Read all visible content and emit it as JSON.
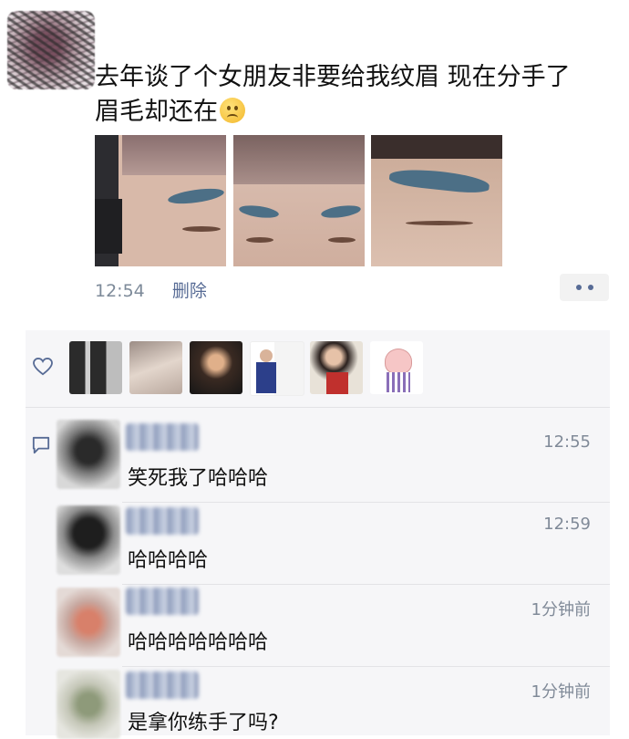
{
  "post": {
    "text_line1": "去年谈了个女朋友非要给我纹眉 现在分手了",
    "text_line2": "眉毛却还在",
    "emoji": "sad-face-emoji",
    "time": "12:54",
    "delete_label": "删除",
    "photos": [
      "side-profile-eyebrow-photo",
      "front-face-eyebrows-photo",
      "closeup-eyebrow-photo"
    ]
  },
  "likes": {
    "icon": "heart-icon",
    "avatars": [
      "like-avatar-1",
      "like-avatar-2",
      "like-avatar-3",
      "like-avatar-4",
      "like-avatar-5",
      "like-avatar-6"
    ]
  },
  "comments": [
    {
      "text": "笑死我了哈哈哈",
      "time": "12:55"
    },
    {
      "text": "哈哈哈哈",
      "time": "12:59"
    },
    {
      "text": "哈哈哈哈哈哈哈",
      "time": "1分钟前"
    },
    {
      "text": "是拿你练手了吗?",
      "time": "1分钟前"
    }
  ],
  "colors": {
    "link": "#576b95",
    "meta_gray": "#7d8a99",
    "comment_panel": "#f6f6f8",
    "brow_tattoo": "#4c6f86"
  }
}
